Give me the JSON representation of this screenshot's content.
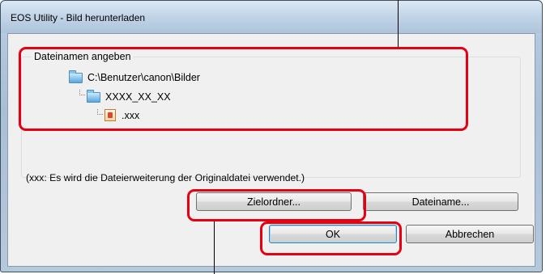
{
  "window": {
    "title": "EOS Utility - Bild herunterladen"
  },
  "group": {
    "label": "Dateinamen angeben",
    "tree": {
      "root": "C:\\Benutzer\\canon\\Bilder",
      "folder": "XXXX_XX_XX",
      "file": ".xxx"
    }
  },
  "note": "(xxx: Es wird die Dateierweiterung der Originaldatei verwendet.)",
  "buttons": {
    "target_folder": "Zielordner...",
    "file_name": "Dateiname...",
    "ok": "OK",
    "cancel": "Abbrechen"
  },
  "icons": {
    "root": "folder-icon",
    "folder": "folder-icon",
    "file": "image-file-icon"
  },
  "colors": {
    "highlight": "#e60012"
  }
}
